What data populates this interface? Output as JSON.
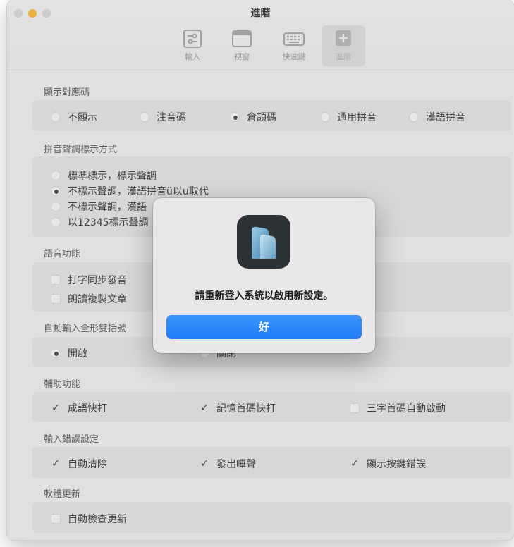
{
  "window": {
    "title": "進階",
    "toolbar": [
      {
        "label": "輸入",
        "icon": "sliders-icon"
      },
      {
        "label": "視窗",
        "icon": "window-icon"
      },
      {
        "label": "快速鍵",
        "icon": "keyboard-icon"
      },
      {
        "label": "進階",
        "icon": "plus-square-icon"
      }
    ]
  },
  "sections": {
    "display_codes": {
      "title": "顯示對應碼",
      "options": [
        "不顯示",
        "注音碼",
        "倉頡碼",
        "通用拼音",
        "漢語拼音"
      ],
      "selected": "倉頡碼"
    },
    "pinyin_tone": {
      "title": "拼音聲調標示方式",
      "options": [
        "標準標示，標示聲調",
        "不標示聲調，漢語拼音ü以u取代",
        "不標示聲調，漢語",
        "以12345標示聲調"
      ],
      "selected": "不標示聲調，漢語拼音ü以u取代"
    },
    "speech": {
      "title": "語音功能",
      "options": [
        "打字同步發音",
        "朗讀複製文章"
      ]
    },
    "fullwidth": {
      "title": "自動輸入全形雙括號",
      "options": [
        "開啟",
        "關閉"
      ],
      "selected": "開啟"
    },
    "assist": {
      "title": "輔助功能",
      "options": [
        {
          "label": "成語快打",
          "checked": true
        },
        {
          "label": "記憶首碼快打",
          "checked": true
        },
        {
          "label": "三字首碼自動啟動",
          "checked": false
        }
      ]
    },
    "input_error": {
      "title": "輸入錯誤設定",
      "options": [
        {
          "label": "自動清除",
          "checked": true
        },
        {
          "label": "發出嗶聲",
          "checked": true
        },
        {
          "label": "顯示按鍵錯誤",
          "checked": true
        }
      ]
    },
    "update": {
      "title": "軟體更新",
      "options": [
        {
          "label": "自動檢查更新",
          "checked": false
        }
      ]
    }
  },
  "dialog": {
    "message": "請重新登入系統以啟用新設定。",
    "ok_label": "好"
  },
  "marks": {
    "check": "✓"
  },
  "colors": {
    "accent": "#1f7cf6",
    "traffic_yellow": "#f6b73c"
  }
}
